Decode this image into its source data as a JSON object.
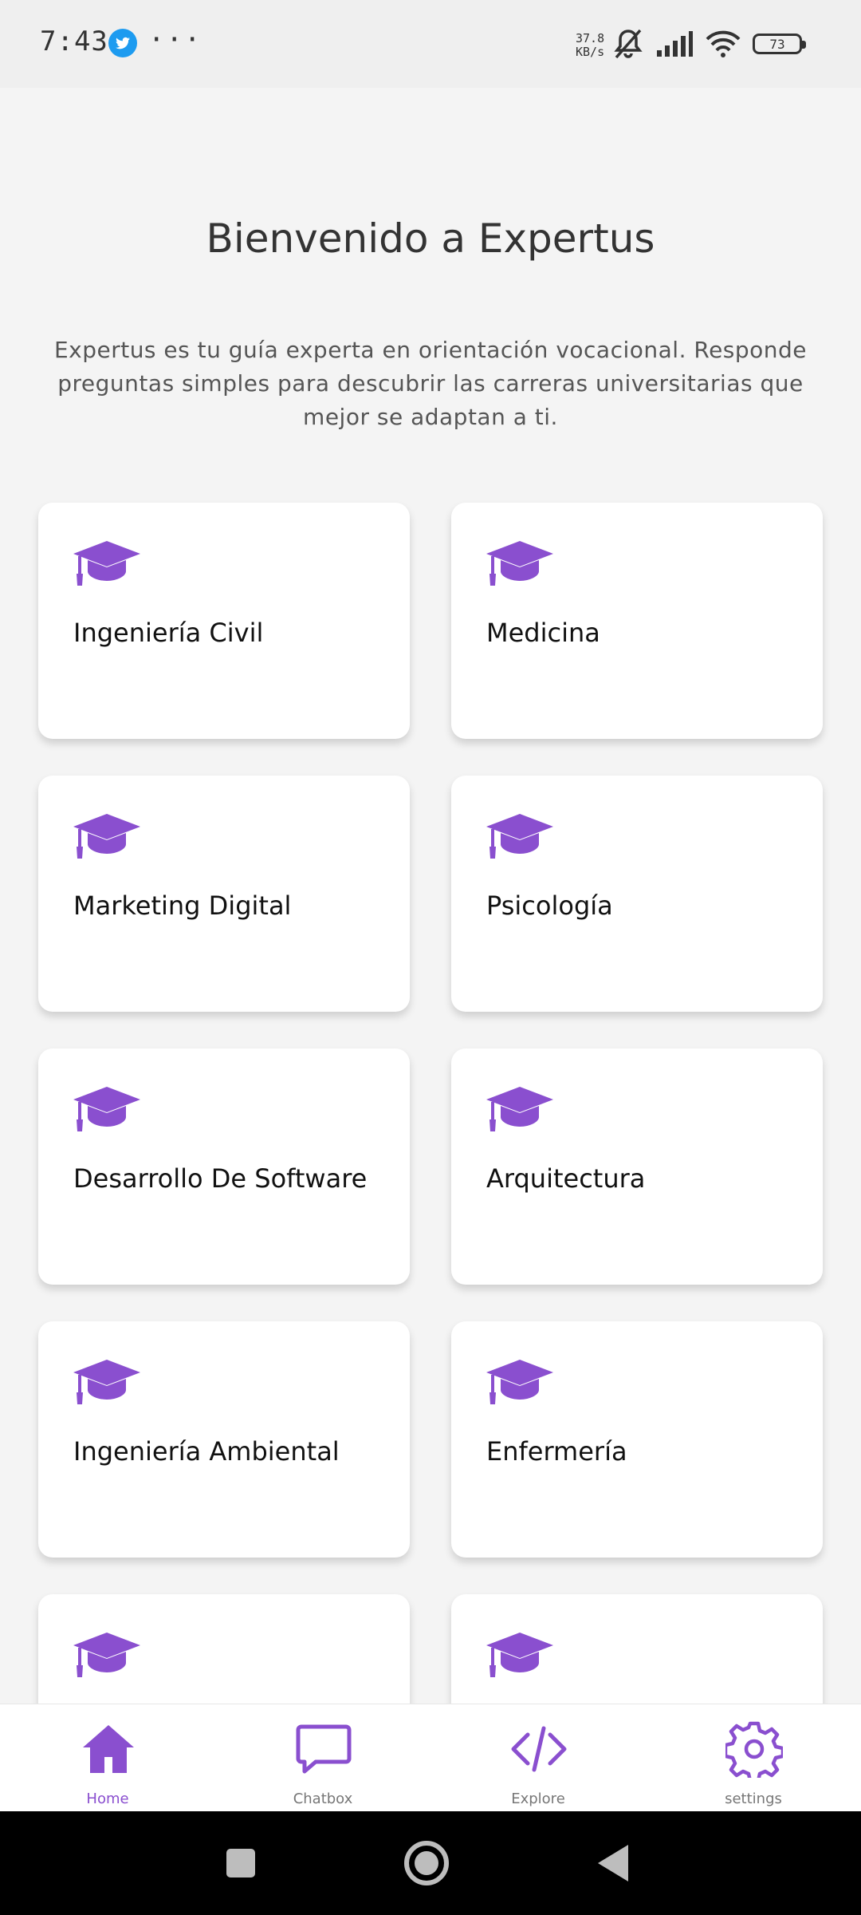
{
  "status_bar": {
    "time": "7:43",
    "net_speed_value": "37.8",
    "net_speed_unit": "KB/s",
    "battery": "73",
    "icons": [
      "twitter-icon",
      "more-dots-icon",
      "bell-off-icon",
      "signal-icon",
      "wifi-icon",
      "battery-icon"
    ]
  },
  "header": {
    "title": "Bienvenido a Expertus",
    "description": "Expertus es tu guía experta en orientación vocacional. Responde preguntas simples para descubrir las carreras universitarias que mejor se adaptan a ti."
  },
  "careers": [
    {
      "label": "Ingeniería Civil",
      "icon": "graduation-cap-icon"
    },
    {
      "label": "Medicina",
      "icon": "graduation-cap-icon"
    },
    {
      "label": "Marketing Digital",
      "icon": "graduation-cap-icon"
    },
    {
      "label": "Psicología",
      "icon": "graduation-cap-icon"
    },
    {
      "label": "Desarrollo De Software",
      "icon": "graduation-cap-icon"
    },
    {
      "label": "Arquitectura",
      "icon": "graduation-cap-icon"
    },
    {
      "label": "Ingeniería Ambiental",
      "icon": "graduation-cap-icon"
    },
    {
      "label": "Enfermería",
      "icon": "graduation-cap-icon"
    },
    {
      "label": "",
      "icon": "graduation-cap-icon"
    },
    {
      "label": "",
      "icon": "graduation-cap-icon"
    }
  ],
  "bottom_nav": {
    "items": [
      {
        "label": "Home",
        "icon": "home-icon",
        "active": true
      },
      {
        "label": "Chatbox",
        "icon": "chat-icon",
        "active": false
      },
      {
        "label": "Explore",
        "icon": "code-icon",
        "active": false
      },
      {
        "label": "settings",
        "icon": "gear-icon",
        "active": false
      }
    ]
  },
  "colors": {
    "accent": "#8a4fcf",
    "background": "#f4f4f4",
    "card": "#ffffff"
  }
}
